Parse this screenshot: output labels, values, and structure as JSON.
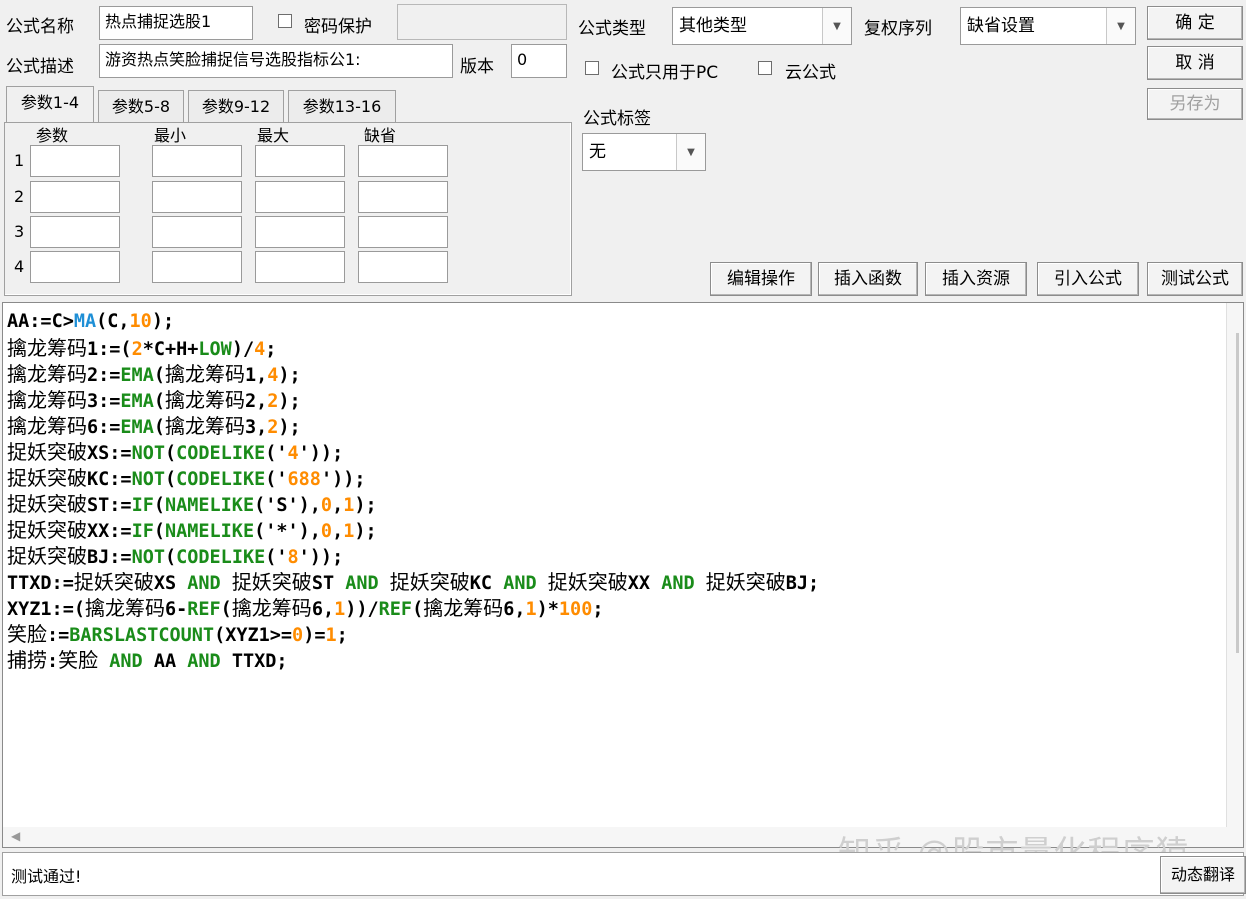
{
  "header": {
    "name_label": "公式名称",
    "name_value": "热点捕捉选股1",
    "password_label": "密码保护",
    "password_value": "",
    "desc_label": "公式描述",
    "desc_value": "游资热点笑脸捕捉信号选股指标公1:",
    "version_label": "版本",
    "version_value": "0"
  },
  "type": {
    "label": "公式类型",
    "value": "其他类型",
    "rights_label": "复权序列",
    "rights_value": "缺省设置",
    "pc_only_label": "公式只用于PC",
    "cloud_label": "云公式",
    "tag_label": "公式标签",
    "tag_value": "无"
  },
  "actions": {
    "ok": "确  定",
    "cancel": "取  消",
    "save_as": "另存为",
    "edit_ops": "编辑操作",
    "insert_func": "插入函数",
    "insert_res": "插入资源",
    "import": "引入公式",
    "test": "测试公式",
    "translate": "动态翻译"
  },
  "params": {
    "tabs": [
      "参数1-4",
      "参数5-8",
      "参数9-12",
      "参数13-16"
    ],
    "active_tab": 0,
    "columns": [
      "参数",
      "最小",
      "最大",
      "缺省"
    ],
    "rows": [
      "1",
      "2",
      "3",
      "4"
    ]
  },
  "editor": {
    "lines": [
      [
        [
          "AA:=",
          ""
        ],
        [
          "C",
          ""
        ],
        [
          ">",
          ""
        ],
        [
          "MA",
          "b"
        ],
        [
          "(C,",
          ""
        ],
        [
          "10",
          "n"
        ],
        [
          ");",
          ""
        ]
      ],
      [
        [
          "擒龙筹码",
          "cn"
        ],
        [
          "1:=(",
          ""
        ],
        [
          "2",
          "n"
        ],
        [
          "*C+H+",
          ""
        ],
        [
          "LOW",
          "k"
        ],
        [
          ")/",
          ""
        ],
        [
          "4",
          "n"
        ],
        [
          ";",
          ""
        ]
      ],
      [
        [
          "擒龙筹码",
          "cn"
        ],
        [
          "2:=",
          ""
        ],
        [
          "EMA",
          "k"
        ],
        [
          "(",
          ""
        ],
        [
          "擒龙筹码",
          "cn"
        ],
        [
          "1,",
          ""
        ],
        [
          "4",
          "n"
        ],
        [
          ");",
          ""
        ]
      ],
      [
        [
          "擒龙筹码",
          "cn"
        ],
        [
          "3:=",
          ""
        ],
        [
          "EMA",
          "k"
        ],
        [
          "(",
          ""
        ],
        [
          "擒龙筹码",
          "cn"
        ],
        [
          "2,",
          ""
        ],
        [
          "2",
          "n"
        ],
        [
          ");",
          ""
        ]
      ],
      [
        [
          "擒龙筹码",
          "cn"
        ],
        [
          "6:=",
          ""
        ],
        [
          "EMA",
          "k"
        ],
        [
          "(",
          ""
        ],
        [
          "擒龙筹码",
          "cn"
        ],
        [
          "3,",
          ""
        ],
        [
          "2",
          "n"
        ],
        [
          ");",
          ""
        ]
      ],
      [
        [
          "捉妖突破",
          "cn"
        ],
        [
          "XS:=",
          ""
        ],
        [
          "NOT",
          "k"
        ],
        [
          "(",
          ""
        ],
        [
          "CODELIKE",
          "k"
        ],
        [
          "('",
          ""
        ],
        [
          "4",
          "n"
        ],
        [
          "'));",
          ""
        ]
      ],
      [
        [
          "捉妖突破",
          "cn"
        ],
        [
          "KC:=",
          ""
        ],
        [
          "NOT",
          "k"
        ],
        [
          "(",
          ""
        ],
        [
          "CODELIKE",
          "k"
        ],
        [
          "('",
          ""
        ],
        [
          "688",
          "n"
        ],
        [
          "'));",
          ""
        ]
      ],
      [
        [
          "捉妖突破",
          "cn"
        ],
        [
          "ST:=",
          ""
        ],
        [
          "IF",
          "k"
        ],
        [
          "(",
          ""
        ],
        [
          "NAMELIKE",
          "k"
        ],
        [
          "('S'),",
          ""
        ],
        [
          "0",
          "n"
        ],
        [
          ",",
          ""
        ],
        [
          "1",
          "n"
        ],
        [
          ");",
          ""
        ]
      ],
      [
        [
          "捉妖突破",
          "cn"
        ],
        [
          "XX:=",
          ""
        ],
        [
          "IF",
          "k"
        ],
        [
          "(",
          ""
        ],
        [
          "NAMELIKE",
          "k"
        ],
        [
          "('*'),",
          ""
        ],
        [
          "0",
          "n"
        ],
        [
          ",",
          ""
        ],
        [
          "1",
          "n"
        ],
        [
          ");",
          ""
        ]
      ],
      [
        [
          "捉妖突破",
          "cn"
        ],
        [
          "BJ:=",
          ""
        ],
        [
          "NOT",
          "k"
        ],
        [
          "(",
          ""
        ],
        [
          "CODELIKE",
          "k"
        ],
        [
          "('",
          ""
        ],
        [
          "8",
          "n"
        ],
        [
          "'));",
          ""
        ]
      ],
      [
        [
          "TTXD:=",
          ""
        ],
        [
          "捉妖突破",
          "cn"
        ],
        [
          "XS ",
          ""
        ],
        [
          "AND",
          "k"
        ],
        [
          " ",
          ""
        ],
        [
          "捉妖突破",
          "cn"
        ],
        [
          "ST ",
          ""
        ],
        [
          "AND",
          "k"
        ],
        [
          " ",
          ""
        ],
        [
          "捉妖突破",
          "cn"
        ],
        [
          "KC ",
          ""
        ],
        [
          "AND",
          "k"
        ],
        [
          " ",
          ""
        ],
        [
          "捉妖突破",
          "cn"
        ],
        [
          "XX ",
          ""
        ],
        [
          "AND",
          "k"
        ],
        [
          " ",
          ""
        ],
        [
          "捉妖突破",
          "cn"
        ],
        [
          "BJ;",
          ""
        ]
      ],
      [
        [
          "XYZ1:=(",
          ""
        ],
        [
          "擒龙筹码",
          "cn"
        ],
        [
          "6-",
          ""
        ],
        [
          "REF",
          "k"
        ],
        [
          "(",
          ""
        ],
        [
          "擒龙筹码",
          "cn"
        ],
        [
          "6,",
          ""
        ],
        [
          "1",
          "n"
        ],
        [
          "))/",
          ""
        ],
        [
          "REF",
          "k"
        ],
        [
          "(",
          ""
        ],
        [
          "擒龙筹码",
          "cn"
        ],
        [
          "6,",
          ""
        ],
        [
          "1",
          "n"
        ],
        [
          ")*",
          ""
        ],
        [
          "100",
          "n"
        ],
        [
          ";",
          ""
        ]
      ],
      [
        [
          "笑脸",
          "cn"
        ],
        [
          ":=",
          ""
        ],
        [
          "BARSLASTCOUNT",
          "k"
        ],
        [
          "(XYZ1>=",
          ""
        ],
        [
          "0",
          "n"
        ],
        [
          ")=",
          ""
        ],
        [
          "1",
          "n"
        ],
        [
          ";",
          ""
        ]
      ],
      [
        [
          "捕捞",
          "cn"
        ],
        [
          ":",
          ""
        ],
        [
          "笑脸",
          "cn"
        ],
        [
          " ",
          ""
        ],
        [
          "AND",
          "k"
        ],
        [
          " AA ",
          ""
        ],
        [
          "AND",
          "k"
        ],
        [
          " TTXD;",
          ""
        ]
      ]
    ]
  },
  "status_text": "测试通过!",
  "watermark": "知乎 @股市量化程序猿",
  "colors": {
    "keyword": "#1a8c1a",
    "number": "#ff8c00",
    "builtin": "#1e8fd6"
  }
}
